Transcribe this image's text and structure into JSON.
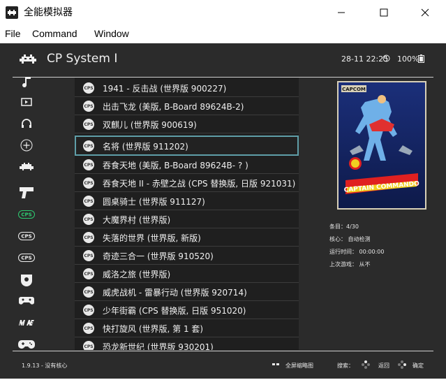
{
  "window": {
    "title": "全能模拟器",
    "icon": "retroarch-invader-icon",
    "controls": [
      "minimize-icon",
      "maximize-icon",
      "close-icon"
    ]
  },
  "menu": {
    "items": [
      "File",
      "Command",
      "Window"
    ]
  },
  "header": {
    "title": "CP System I",
    "clock": "28-11 22:25",
    "battery": "100%"
  },
  "sidebar": {
    "icons": [
      "music-icon",
      "video-icon",
      "headphones-icon",
      "add-icon",
      "invader-icon",
      "lightgun-icon",
      "cps1-icon",
      "cps2-icon",
      "cps3-icon",
      "dreamcast-icon",
      "gamecube-icon",
      "mame-icon",
      "gamepad-icon"
    ]
  },
  "list": {
    "selected_index": 3,
    "badge": "CPS",
    "items": [
      "1941 - 反击战 (世界版 900227)",
      "出击飞龙 (美版, B-Board 89624B-2)",
      "双麒儿 (世界版 900619)",
      "名将 (世界版 911202)",
      "吞食天地 (美版, B-Board 89624B- ? )",
      "吞食天地 II - 赤壁之战 (CPS 替换版, 日版 921031)",
      "圆桌骑士 (世界版 911127)",
      "大魔界村 (世界版)",
      "失落的世界 (世界版, 新版)",
      "奇迹三合一 (世界版 910520)",
      "威洛之旅 (世界版)",
      "威虎战机 - 雷暴行动 (世界版 920714)",
      "少年街霸 (CPS 替换版, 日版 951020)",
      "快打旋风 (世界版, 第 1 套)",
      "恐龙新世纪 (世界版 930201)"
    ]
  },
  "cover": {
    "publisher": "CAPCOM",
    "logo": "CAPTAIN COMMANDO"
  },
  "info": {
    "entry": "条目：4/30",
    "core": "核心： 自动检测",
    "runtime": "运行时间： 00:00:00",
    "last_played": "上次游戏： 从不"
  },
  "footer": {
    "version": "1.9.13 - 没有核心",
    "thumbnail": "全屏缩略图",
    "search": "搜索：",
    "back": "返回",
    "ok": "确定"
  },
  "colors": {
    "background": "#2b2b2b",
    "list_background": "#1f1f1f",
    "selection_border": "#5f9ea8",
    "cps_green": "#2ecc71"
  }
}
